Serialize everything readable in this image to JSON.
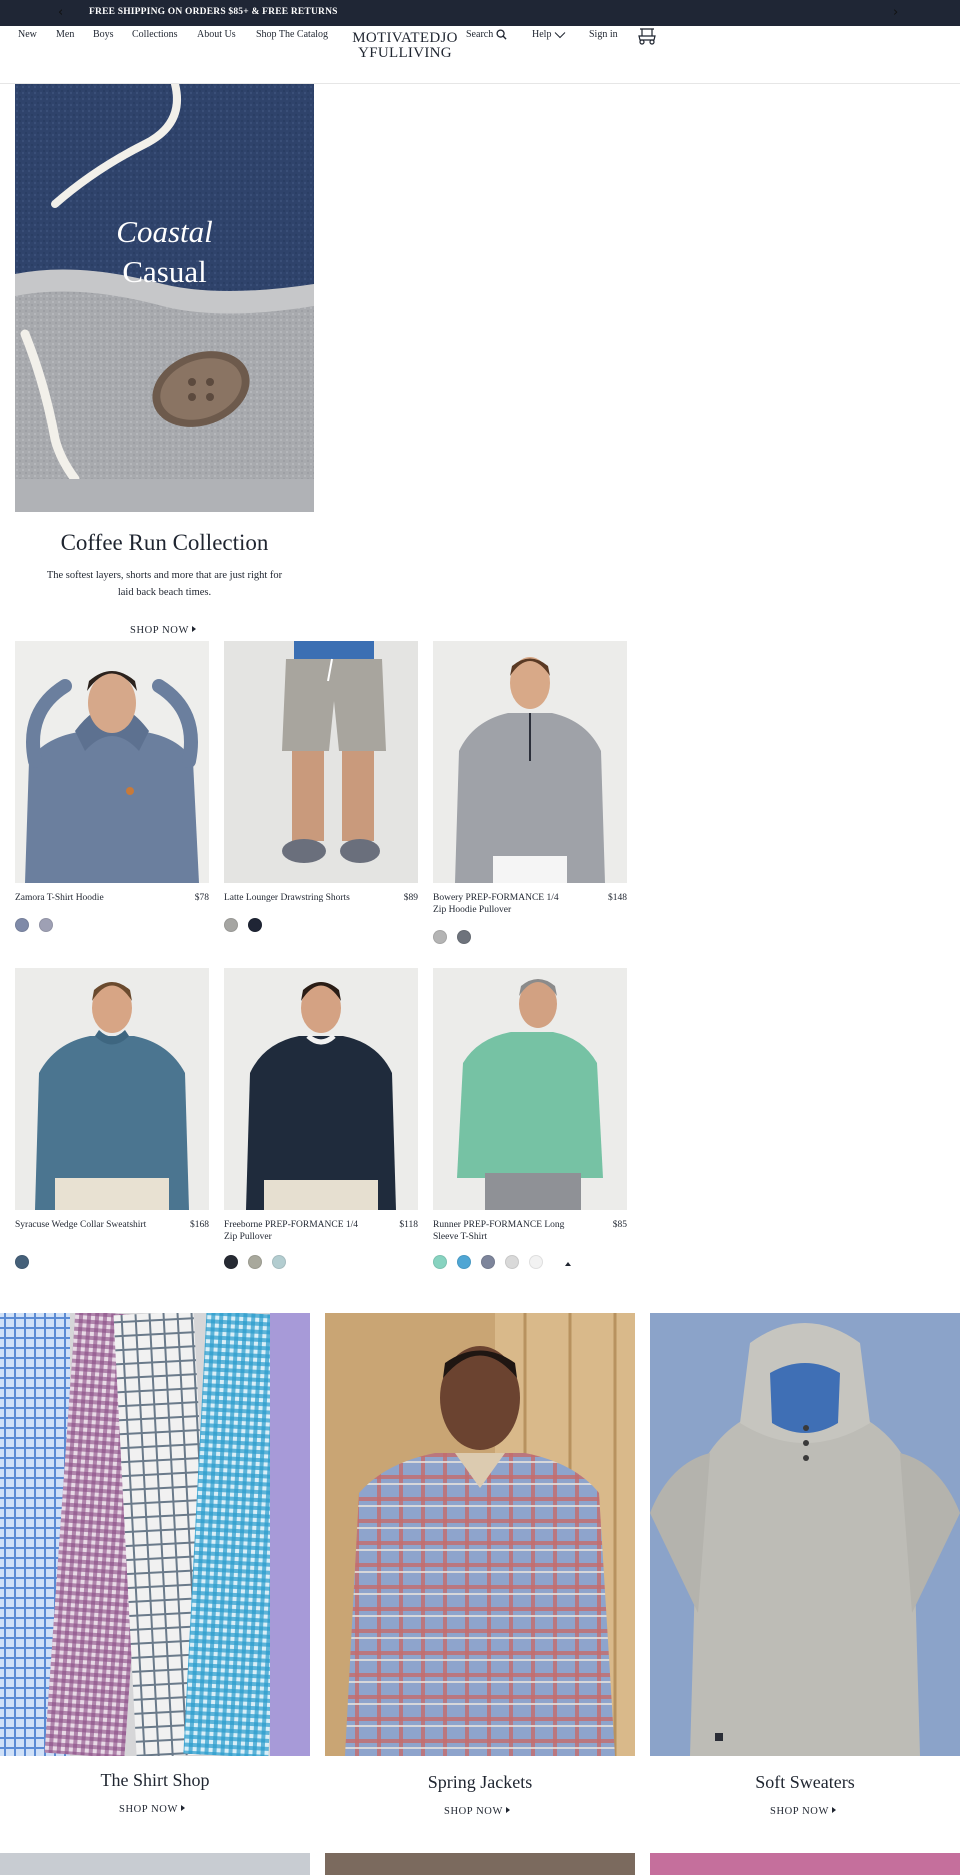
{
  "promo": {
    "text": "FREE SHIPPING ON ORDERS $85+ & FREE RETURNS",
    "prev_icon": "chevron-left-icon",
    "next_icon": "chevron-right-icon"
  },
  "header": {
    "nav": [
      "New",
      "Men",
      "Boys",
      "Collections",
      "About Us",
      "Shop The Catalog"
    ],
    "logo": "MOTIVATEDJOYFULLIVING",
    "search_label": "Search",
    "help_label": "Help",
    "signin_label": "Sign in",
    "cart_icon": "golf-cart-icon"
  },
  "hero": {
    "title_line1": "Coastal",
    "title_line2": "Casual",
    "collection_title": "Coffee Run Collection",
    "description": "The softest layers, shorts and more that are just right for laid back beach times.",
    "cta": "SHOP NOW"
  },
  "products": [
    {
      "name": "Zamora T-Shirt Hoodie",
      "price": "$78",
      "swatches": [
        "#7f8aa8",
        "#9ea0b4"
      ]
    },
    {
      "name": "Latte Lounger Drawstring Shorts",
      "price": "$89",
      "swatches": [
        "#a5a5a2",
        "#1f2535"
      ]
    },
    {
      "name": "Bowery PREP-FORMANCE 1/4 Zip Hoodie Pullover",
      "price": "$148",
      "swatches": [
        "#b4b4b4",
        "#6e737c"
      ]
    },
    {
      "name": "Syracuse Wedge Collar Sweatshirt",
      "price": "$168",
      "swatches": [
        "#456079"
      ]
    },
    {
      "name": "Freeborne PREP-FORMANCE 1/4 Zip Pullover",
      "price": "$118",
      "swatches": [
        "#262a33",
        "#a8a89c",
        "#b3cdd0"
      ]
    },
    {
      "name": "Runner PREP-FORMANCE Long Sleeve T-Shirt",
      "price": "$85",
      "swatches": [
        "#87d3c0",
        "#4fa6d4",
        "#7d859b",
        "#d9d9d9",
        "#f2f2f2"
      ]
    }
  ],
  "categories": [
    {
      "title": "The Shirt Shop",
      "cta": "SHOP NOW"
    },
    {
      "title": "Spring Jackets",
      "cta": "SHOP NOW"
    },
    {
      "title": "Soft Sweaters",
      "cta": "SHOP NOW"
    }
  ],
  "colors": {
    "promo_bg": "#1f2635",
    "text": "#1f2530"
  }
}
